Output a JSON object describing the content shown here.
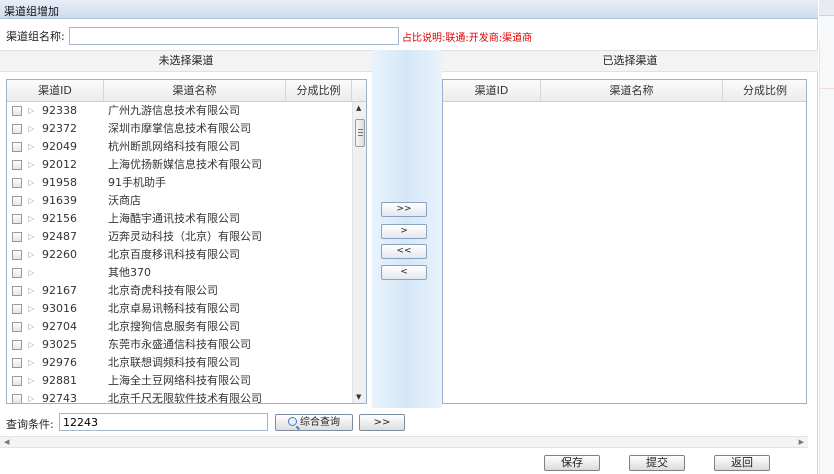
{
  "dialog": {
    "title": "渠道组增加"
  },
  "name_row": {
    "label": "渠道组名称:",
    "value": "",
    "note": "占比说明:联通:开发商:渠道商"
  },
  "left_panel": {
    "title": "未选择渠道",
    "columns": [
      "渠道ID",
      "渠道名称",
      "分成比例"
    ],
    "rows": [
      {
        "id": "92338",
        "name": "广州九游信息技术有限公司"
      },
      {
        "id": "92372",
        "name": "深圳市摩掌信息技术有限公司"
      },
      {
        "id": "92049",
        "name": "杭州断凯网络科技有限公司"
      },
      {
        "id": "92012",
        "name": "上海优扬新媒信息技术有限公司"
      },
      {
        "id": "91958",
        "name": "91手机助手"
      },
      {
        "id": "91639",
        "name": "沃商店"
      },
      {
        "id": "92156",
        "name": "上海酷宇通讯技术有限公司"
      },
      {
        "id": "92487",
        "name": "迈奔灵动科技（北京）有限公司"
      },
      {
        "id": "92260",
        "name": "北京百度移讯科技有限公司"
      },
      {
        "id": "",
        "name": "其他370"
      },
      {
        "id": "92167",
        "name": "北京奇虎科技有限公司"
      },
      {
        "id": "93016",
        "name": "北京卓易讯畅科技有限公司"
      },
      {
        "id": "92704",
        "name": "北京搜狗信息服务有限公司"
      },
      {
        "id": "93025",
        "name": "东莞市永盛通信科技有限公司"
      },
      {
        "id": "92976",
        "name": "北京联想调频科技有限公司"
      },
      {
        "id": "92881",
        "name": "上海全土豆网络科技有限公司"
      },
      {
        "id": "92743",
        "name": "北京千尺无限软件技术有限公司"
      }
    ]
  },
  "right_panel": {
    "title": "已选择渠道",
    "columns": [
      "渠道ID",
      "渠道名称",
      "分成比例"
    ]
  },
  "move_buttons": {
    "add_all": ">>",
    "add_one": ">",
    "remove_all": "<<",
    "remove_one": "<"
  },
  "query": {
    "label": "查询条件:",
    "value": "12243",
    "search_label": "综合查询",
    "go_label": ">>"
  },
  "footer": {
    "save": "保存",
    "submit": "提交",
    "back": "返回"
  }
}
